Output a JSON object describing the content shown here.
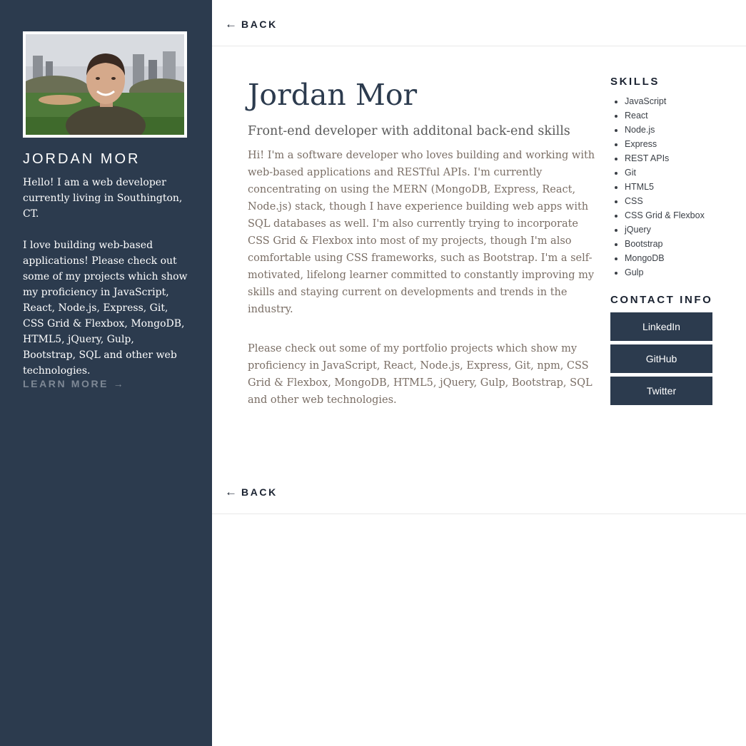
{
  "sidebar": {
    "name": "JORDAN MOR",
    "bio": [
      "Hello! I am a web developer currently living in Southington, CT.",
      "I love building web-based applications! Please check out some of my projects which show my proficiency in JavaScript, React, Node.js, Express, Git, CSS Grid & Flexbox, MongoDB, HTML5, jQuery, Gulp, Bootstrap, SQL and other web technologies."
    ],
    "learn_more": "LEARN MORE",
    "learn_more_arrow": "→"
  },
  "nav": {
    "back_arrow": "←",
    "back_label": "BACK"
  },
  "main": {
    "title": "Jordan Mor",
    "subtitle": "Front-end developer with additonal back-end skills",
    "paragraphs": [
      "Hi! I'm a software developer who loves building and working with web-based applications and RESTful APIs. I'm currently concentrating on using the MERN (MongoDB, Express, React, Node.js) stack, though I have experience building web apps with SQL databases as well. I'm also currently trying to incorporate CSS Grid & Flexbox into most of my projects, though I'm also comfortable using CSS frameworks, such as Bootstrap. I'm a self-motivated, lifelong learner committed to constantly improving my skills and staying current on developments and trends in the industry.",
      "Please check out some of my portfolio projects which show my proficiency in JavaScript, React, Node.js, Express, Git, npm, CSS Grid & Flexbox, MongoDB, HTML5, jQuery, Gulp, Bootstrap, SQL and other web technologies."
    ]
  },
  "aside": {
    "skills_heading": "SKILLS",
    "skills": [
      "JavaScript",
      "React",
      "Node.js",
      "Express",
      "REST APIs",
      "Git",
      "HTML5",
      "CSS",
      "CSS Grid & Flexbox",
      "jQuery",
      "Bootstrap",
      "MongoDB",
      "Gulp"
    ],
    "contact_heading": "CONTACT INFO",
    "contacts": [
      "LinkedIn",
      "GitHub",
      "Twitter"
    ]
  },
  "colors": {
    "sidebar_bg": "#2c3b4e",
    "button_bg": "#2c3b4e",
    "title_color": "#2c3b4e",
    "body_text": "#7a6e65"
  },
  "icons": {
    "avatar": "profile-photo",
    "back": "left-arrow-icon",
    "learn_more": "right-arrow-icon"
  }
}
